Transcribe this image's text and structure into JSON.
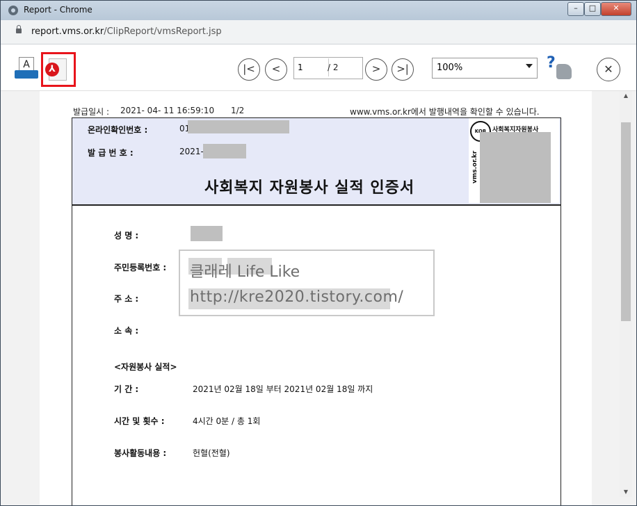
{
  "window": {
    "title": "Report - Chrome",
    "controls": {
      "minimize": "–",
      "maximize": "□",
      "close": "✕"
    }
  },
  "address": {
    "url_host": "report.vms.or.kr",
    "url_path": "/ClipReport/vmsReport.jsp"
  },
  "toolbar": {
    "print_glyph": "A",
    "pdf_glyph": "⅄",
    "first_glyph": "|<",
    "prev_glyph": "<",
    "page_current": "1",
    "page_total": "/ 2",
    "next_glyph": ">",
    "last_glyph": ">|",
    "zoom_value": "100%",
    "help_glyph": "?",
    "close_glyph": "✕"
  },
  "report": {
    "issue_label": "발급일시 :",
    "issue_datetime": "2021- 04- 11 16:59:10",
    "page_indicator": "1/2",
    "verify_note": "www.vms.or.kr에서 발행내역을 확인할 수 있습니다.",
    "online_label": "온라인확인번호 :",
    "online_value": "01",
    "issue_no_label": "발 급 번 호 :",
    "issue_no_value": "2021-",
    "cert_title": "사회복지 자원봉사 실적 인증서",
    "stamp_kor": "KOR",
    "stamp_org": "사회복지자원봉사",
    "stamp_vms": "vms.or.kr",
    "name_label": "성          명 :",
    "rrn_label": "주민등록번호 :",
    "address_label": "주          소 :",
    "affil_label": "소          속 :",
    "section_title": "<자원봉사 실적>",
    "period_label": "기          간 :",
    "period_value": "2021년 02월 18일 부터 2021년 02월 18일 까지",
    "hours_label": "시간 및 횟수 :",
    "hours_value": "4시간 0분 / 총 1회",
    "content_label": "봉사활동내용 :",
    "content_value": "헌혈(전혈)"
  },
  "watermark": {
    "line1": "클래레 Life Like",
    "line2": "http://kre2020.tistory.com/"
  },
  "colors": {
    "pdf_highlight": "#e8141b",
    "cert_header_bg": "#e6e9f8",
    "help_blue": "#1e5fb4"
  }
}
